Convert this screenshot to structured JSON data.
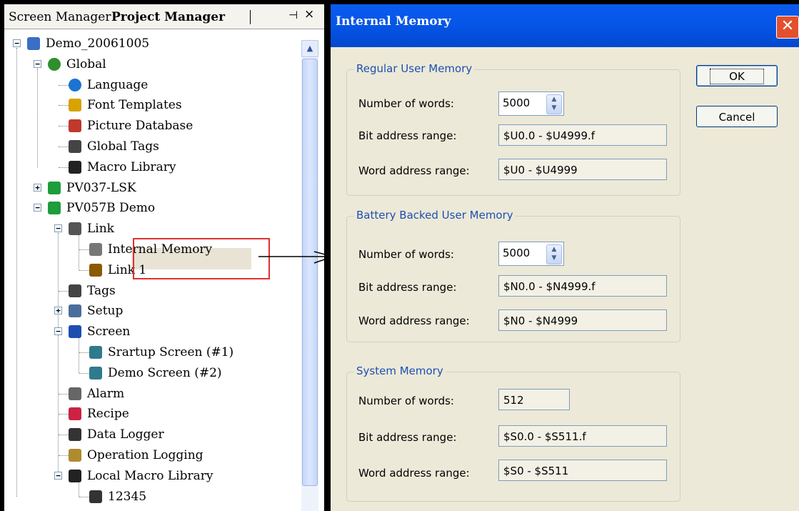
{
  "pane": {
    "tabs": [
      "Screen Manager",
      "Project Manager"
    ],
    "pin_icon": "pin-icon",
    "close_icon": "close-icon"
  },
  "tree": {
    "nodes": [
      {
        "label": "Demo_20061005",
        "icon": "project-icon",
        "expander": "−"
      },
      {
        "label": "Global",
        "icon": "globe-pin-icon",
        "expander": "−"
      },
      {
        "label": "Language",
        "icon": "earth-icon"
      },
      {
        "label": "Font Templates",
        "icon": "font-icon"
      },
      {
        "label": "Picture Database",
        "icon": "picture-icon"
      },
      {
        "label": "Global Tags",
        "icon": "tag-icon"
      },
      {
        "label": "Macro Library",
        "icon": "book-icon"
      },
      {
        "label": "PV037-LSK",
        "icon": "device-icon",
        "expander": "+"
      },
      {
        "label": "PV057B Demo",
        "icon": "device-icon",
        "expander": "−"
      },
      {
        "label": "Link",
        "icon": "link-icon",
        "expander": "−"
      },
      {
        "label": "Internal Memory",
        "icon": "chip-icon"
      },
      {
        "label": "Link 1",
        "icon": "network-icon"
      },
      {
        "label": "Tags",
        "icon": "tag-icon"
      },
      {
        "label": "Setup",
        "icon": "wrench-icon",
        "expander": "+"
      },
      {
        "label": "Screen",
        "icon": "screen-icon",
        "expander": "−"
      },
      {
        "label": "Srartup Screen (#1)",
        "icon": "screen-item-icon"
      },
      {
        "label": "Demo Screen (#2)",
        "icon": "screen-item-icon"
      },
      {
        "label": "Alarm",
        "icon": "bell-icon"
      },
      {
        "label": "Recipe",
        "icon": "recipe-icon"
      },
      {
        "label": "Data Logger",
        "icon": "logger-icon"
      },
      {
        "label": "Operation Logging",
        "icon": "oplog-icon"
      },
      {
        "label": "Local Macro Library",
        "icon": "book-icon",
        "expander": "−"
      },
      {
        "label": "12345",
        "icon": "macro-icon"
      }
    ]
  },
  "dialog": {
    "title": "Internal Memory",
    "ok": "OK",
    "cancel": "Cancel",
    "regular": {
      "title": "Regular User Memory",
      "words_label": "Number of words:",
      "words": "5000",
      "bit_label": "Bit address range:",
      "bit": "$U0.0 - $U4999.f",
      "word_label": "Word address range:",
      "word": "$U0 - $U4999"
    },
    "battery": {
      "title": "Battery Backed User Memory",
      "words_label": "Number of words:",
      "words": "5000",
      "bit_label": "Bit address range:",
      "bit": "$N0.0 - $N4999.f",
      "word_label": "Word address range:",
      "word": "$N0 - $N4999"
    },
    "system": {
      "title": "System Memory",
      "words_label": "Number of words:",
      "words": "512",
      "bit_label": "Bit address range:",
      "bit": "$S0.0 - $S511.f",
      "word_label": "Word address range:",
      "word": "$S0 - $S511"
    }
  }
}
